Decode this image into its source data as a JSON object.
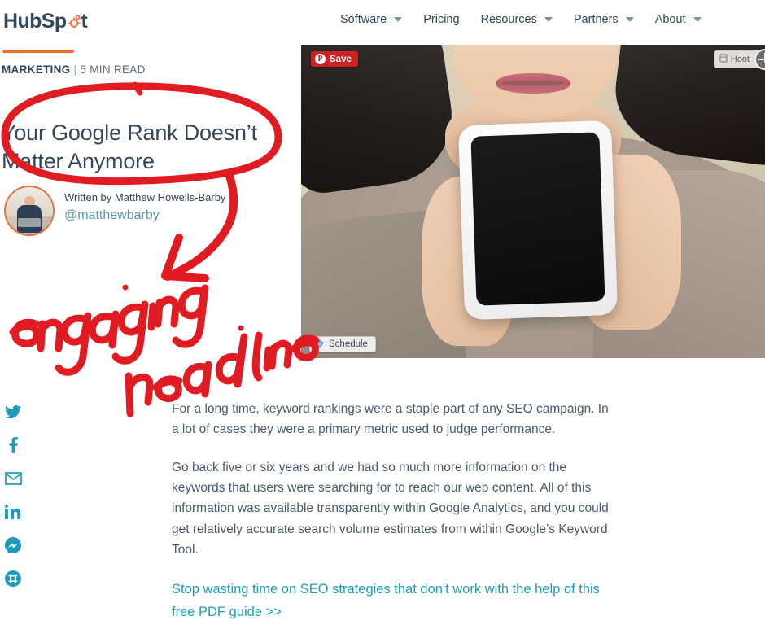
{
  "brand": {
    "logo_text_1": "HubSp",
    "logo_text_2": "t",
    "accent_orange": "#e8703a",
    "accent_teal": "#1b9dba",
    "annotation_red": "#e01b22"
  },
  "nav": {
    "items": [
      {
        "label": "Software",
        "has_caret": true,
        "icon": "chevron-down-icon"
      },
      {
        "label": "Pricing",
        "has_caret": false,
        "icon": ""
      },
      {
        "label": "Resources",
        "has_caret": true,
        "icon": "chevron-down-icon"
      },
      {
        "label": "Partners",
        "has_caret": true,
        "icon": "chevron-down-icon"
      },
      {
        "label": "About",
        "has_caret": true,
        "icon": "chevron-down-icon"
      }
    ]
  },
  "article": {
    "category": "MARKETING",
    "separator": "|",
    "read_time": "5 MIN READ",
    "headline": "Your Google Rank Doesn’t Matter Anymore",
    "author_prefix": "Written by Matthew Howells-Barby",
    "author_handle": "@matthewbarby",
    "paragraphs": [
      "For a long time, keyword rankings were a staple part of any SEO campaign. In a lot of cases they were a primary metric used to judge performance.",
      "Go back five or six years and we had so much more information on the keywords that users were searching for to reach our web content. All of this information was available transparently within Google Analytics, and you could get relatively accurate search volume estimates from within Google’s Keyword Tool."
    ],
    "cta_link": "Stop wasting time on SEO strategies that don't work with the help of this free PDF guide >>"
  },
  "hero": {
    "alt": "Woman holding a white smartphone up toward her mouth",
    "pinterest_save_label": "Save",
    "pinterest_icon": "pinterest-icon",
    "schedule_label": "Schedule",
    "schedule_icon": "hootsuite-owl-icon",
    "hootsuite_label": "Hoot",
    "hootsuite_icon": "hootsuite-icon"
  },
  "social": {
    "items": [
      {
        "name": "twitter-icon",
        "label": "Twitter"
      },
      {
        "name": "facebook-icon",
        "label": "Facebook"
      },
      {
        "name": "email-icon",
        "label": "Email"
      },
      {
        "name": "linkedin-icon",
        "label": "LinkedIn"
      },
      {
        "name": "messenger-icon",
        "label": "Messenger"
      },
      {
        "name": "slack-icon",
        "label": "Slack"
      }
    ]
  },
  "annotation": {
    "handwritten_text": "engaging headline",
    "shapes": [
      "circle-around-headline",
      "curved-arrow",
      "handwritten-label"
    ]
  }
}
